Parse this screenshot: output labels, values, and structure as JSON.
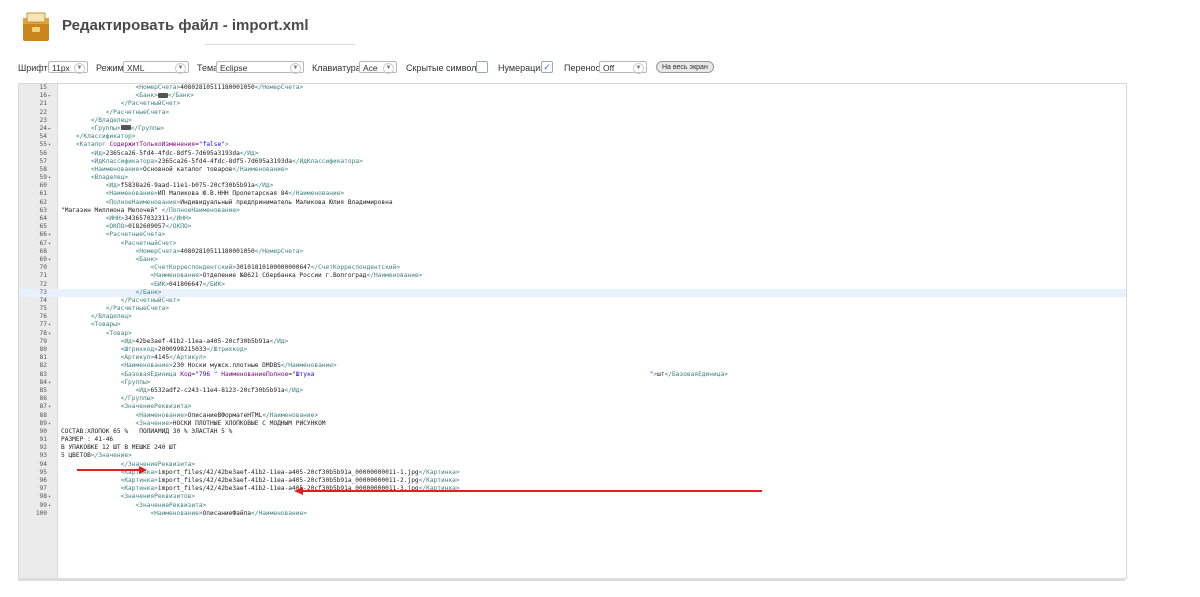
{
  "header": {
    "title": "Редактировать файл - import.xml"
  },
  "toolbar": {
    "font_label": "Шрифт",
    "font_value": "11px",
    "mode_label": "Режим",
    "mode_value": "XML",
    "theme_label": "Тема",
    "theme_value": "Eclipse",
    "keyboard_label": "Клавиатура",
    "keyboard_value": "Ace",
    "hidden_label": "Скрытые символы",
    "hidden_checked": false,
    "numbering_label": "Нумерация",
    "numbering_checked": true,
    "wrap_label": "Перенос",
    "wrap_value": "Off",
    "fullscreen_label": "На весь экран"
  },
  "editor": {
    "active_line": 73,
    "lines": [
      {
        "n": "15",
        "f": "",
        "t": "                    <НомерСчета>40802810511180001050</НомерСчета>"
      },
      {
        "n": "16",
        "f": "▸",
        "t": "                    <Банк>[…]</Банк>"
      },
      {
        "n": "21",
        "f": "",
        "t": "                </РасчетныйСчет>"
      },
      {
        "n": "22",
        "f": "",
        "t": "            </РасчетныеСчета>"
      },
      {
        "n": "23",
        "f": "",
        "t": "        </Владелец>"
      },
      {
        "n": "24",
        "f": "▸",
        "t": "        <Группы>[…]</Группы>"
      },
      {
        "n": "54",
        "f": "",
        "t": "    </Классификатор>"
      },
      {
        "n": "55",
        "f": "▾",
        "t": "    <Каталог СодержитТолькоИзменения=\"false\">"
      },
      {
        "n": "56",
        "f": "",
        "t": "        <Ид>2365ca26-5fd4-4fdc-8df5-7d695a3193da</Ид>"
      },
      {
        "n": "57",
        "f": "",
        "t": "        <ИдКлассификатора>2365ca26-5fd4-4fdc-8df5-7d695a3193da</ИдКлассификатора>"
      },
      {
        "n": "58",
        "f": "",
        "t": "        <Наименование>Основной каталог товаров</Наименование>"
      },
      {
        "n": "59",
        "f": "▾",
        "t": "        <Владелец>"
      },
      {
        "n": "60",
        "f": "",
        "t": "            <Ид>f5838a26-9aad-11e1-b075-20cf30b5b91a</Ид>"
      },
      {
        "n": "61",
        "f": "",
        "t": "            <Наименование>ИП Маликова Ю.В.ННН Пролетарская 84</Наименование>"
      },
      {
        "n": "62",
        "f": "",
        "t": "            <ПолноеНаименование>Индивидуальный предприниматель Маликова Юлия Владимировна"
      },
      {
        "n": "63",
        "f": "",
        "t": "\"Магазин Миллиона Мелочей\" </ПолноеНаименование>"
      },
      {
        "n": "64",
        "f": "",
        "t": "            <ИНН>343657032311</ИНН>"
      },
      {
        "n": "65",
        "f": "",
        "t": "            <ОКПО>0182609057</ОКПО>"
      },
      {
        "n": "66",
        "f": "▾",
        "t": "            <РасчетныеСчета>"
      },
      {
        "n": "67",
        "f": "▾",
        "t": "                <РасчетныйСчет>"
      },
      {
        "n": "68",
        "f": "",
        "t": "                    <НомерСчета>40802810511180001050</НомерСчета>"
      },
      {
        "n": "69",
        "f": "▾",
        "t": "                    <Банк>"
      },
      {
        "n": "70",
        "f": "",
        "t": "                        <СчетКорреспондентский>30101810100000000647</СчетКорреспондентский>"
      },
      {
        "n": "71",
        "f": "",
        "t": "                        <Наименование>Отделение №8621 Сбербанка России г.Волгоград</Наименование>"
      },
      {
        "n": "72",
        "f": "",
        "t": "                        <БИК>041806647</БИК>"
      },
      {
        "n": "73",
        "f": "",
        "t": "                    </Банк>"
      },
      {
        "n": "74",
        "f": "",
        "t": "                </РасчетныйСчет>"
      },
      {
        "n": "75",
        "f": "",
        "t": "            </РасчетныеСчета>"
      },
      {
        "n": "76",
        "f": "",
        "t": "        </Владелец>"
      },
      {
        "n": "77",
        "f": "▾",
        "t": "        <Товары>"
      },
      {
        "n": "78",
        "f": "▾",
        "t": "            <Товар>"
      },
      {
        "n": "79",
        "f": "",
        "t": "                <Ид>42be3aef-41b2-11ea-a405-20cf30b5b91a</Ид>"
      },
      {
        "n": "80",
        "f": "",
        "t": "                <Штрихкод>2000998215033</Штрихкод>"
      },
      {
        "n": "81",
        "f": "",
        "t": "                <Артикул>4145</Артикул>"
      },
      {
        "n": "82",
        "f": "",
        "t": "                <Наименование>230 Носки мужск.плотные DMDBS</Наименование>"
      },
      {
        "n": "83",
        "f": "",
        "t": "                <БазоваяЕдиница Код=\"796 \" НаименованиеПолное=\"Штука                                                                                          \">шт</БазоваяЕдиница>"
      },
      {
        "n": "84",
        "f": "▾",
        "t": "                <Группы>"
      },
      {
        "n": "85",
        "f": "",
        "t": "                    <Ид>6532adf2-c243-11e4-8123-20cf30b5b91a</Ид>"
      },
      {
        "n": "86",
        "f": "",
        "t": "                </Группы>"
      },
      {
        "n": "87",
        "f": "▾",
        "t": "                <ЗначениеРеквизита>"
      },
      {
        "n": "88",
        "f": "",
        "t": "                    <Наименование>ОписаниеВФорматеHTML</Наименование>"
      },
      {
        "n": "89",
        "f": "▾",
        "t": "                    <Значение>НОСКИ ПЛОТНЫЕ ХЛОПКОВЫЕ С МОДНЫМ РИСУНКОМ"
      },
      {
        "n": "90",
        "f": "",
        "t": "СОСТАВ:ХЛОПОК 65 %   ПОЛИАМИД 30 % ЭЛАСТАН 5 %"
      },
      {
        "n": "91",
        "f": "",
        "t": "РАЗМЕР : 41-46"
      },
      {
        "n": "92",
        "f": "",
        "t": "В УПАКОВКЕ 12 ШТ В МЕШКЕ 240 ШТ"
      },
      {
        "n": "93",
        "f": "",
        "t": "5 ЦВЕТОВ</Значение>"
      },
      {
        "n": "94",
        "f": "",
        "t": "                </ЗначениеРеквизита>"
      },
      {
        "n": "95",
        "f": "",
        "t": "                <Картинка>import_files/42/42be3aef-41b2-11ea-a405-20cf30b5b91a_00000000011-1.jpg</Картинка>"
      },
      {
        "n": "96",
        "f": "",
        "t": "                <Картинка>import_files/42/42be3aef-41b2-11ea-a405-20cf30b5b91a_00000000011-2.jpg</Картинка>"
      },
      {
        "n": "97",
        "f": "",
        "t": "                <Картинка>import_files/42/42be3aef-41b2-11ea-a405-20cf30b5b91a_00000000011-3.jpg</Картинка>"
      },
      {
        "n": "98",
        "f": "▾",
        "t": "                <ЗначенияРеквизитов>"
      },
      {
        "n": "99",
        "f": "▾",
        "t": "                    <ЗначениеРеквизита>"
      },
      {
        "n": "100",
        "f": "",
        "t": "                        <Наименование>ОписаниеФайла</Наименование>"
      }
    ]
  },
  "colors": {
    "arrow": "#e02020",
    "active_line": "#e8f2fe",
    "tag": "#3f7f7f",
    "attr": "#7f007f",
    "string": "#2a00ff"
  },
  "icons": {
    "app": "file-package-icon"
  }
}
